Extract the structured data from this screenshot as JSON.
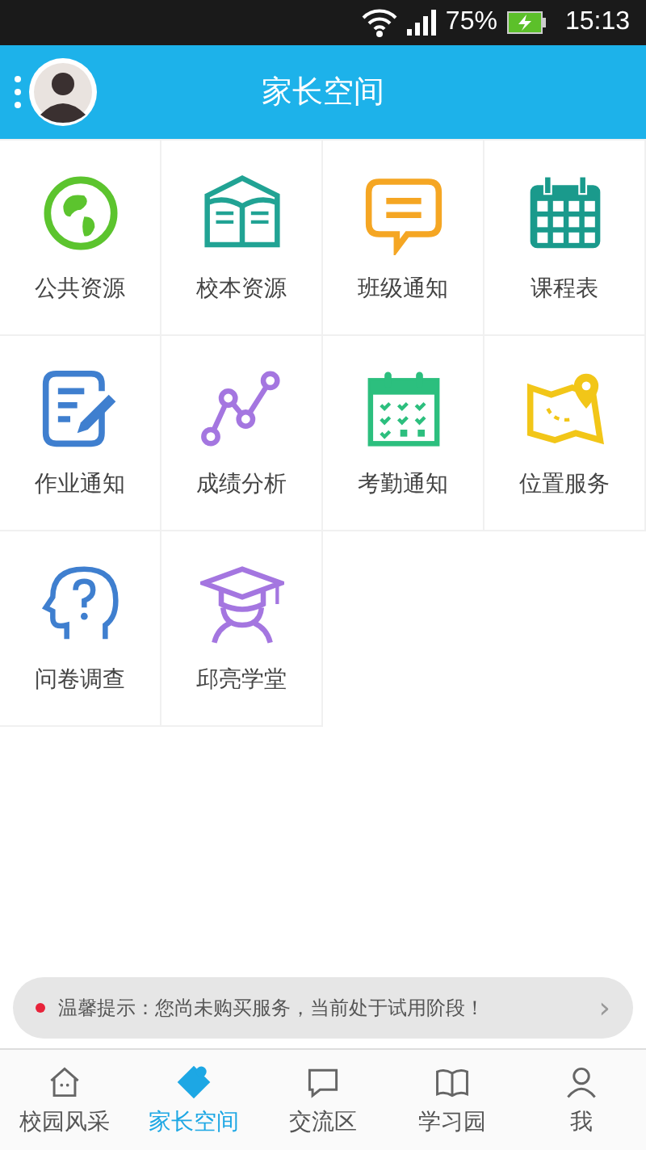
{
  "status_bar": {
    "battery": "75%",
    "time": "15:13"
  },
  "header": {
    "title": "家长空间"
  },
  "features": [
    {
      "label": "公共资源"
    },
    {
      "label": "校本资源"
    },
    {
      "label": "班级通知"
    },
    {
      "label": "课程表"
    },
    {
      "label": "作业通知"
    },
    {
      "label": "成绩分析"
    },
    {
      "label": "考勤通知"
    },
    {
      "label": "位置服务"
    },
    {
      "label": "问卷调查"
    },
    {
      "label": "邱亮学堂"
    }
  ],
  "notice": {
    "text": "温馨提示：您尚未购买服务，当前处于试用阶段！",
    "arrow": "›"
  },
  "tabs": [
    {
      "label": "校园风采",
      "selected": false
    },
    {
      "label": "家长空间",
      "selected": true
    },
    {
      "label": "交流区",
      "selected": false
    },
    {
      "label": "学习园",
      "selected": false
    },
    {
      "label": "我",
      "selected": false
    }
  ]
}
